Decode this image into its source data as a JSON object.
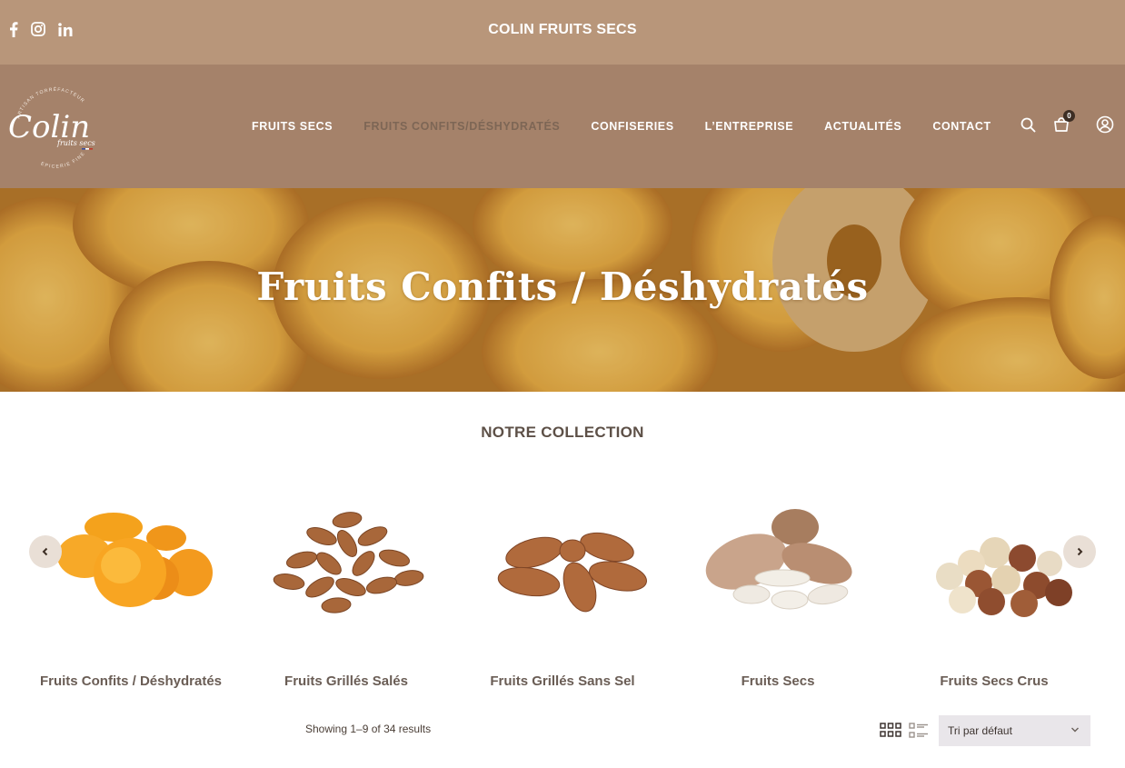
{
  "topbar": {
    "title": "COLIN FRUITS SECS",
    "social": [
      {
        "icon": "facebook-icon",
        "glyph": "f"
      },
      {
        "icon": "instagram-icon",
        "glyph": ""
      },
      {
        "icon": "linkedin-icon",
        "glyph": "in"
      }
    ]
  },
  "logo": {
    "main": "Colin",
    "sub": "fruits secs",
    "ring_top": "ARTISAN TORRÉFACTEUR",
    "ring_bottom": "EPICERIE FINE"
  },
  "nav": {
    "items": [
      {
        "label": "FRUITS SECS",
        "active": false
      },
      {
        "label": "FRUITS CONFITS/DÉSHYDRATÉS",
        "active": true
      },
      {
        "label": "CONFISERIES",
        "active": false
      },
      {
        "label": "L’ENTREPRISE",
        "active": false
      },
      {
        "label": "ACTUALITÉS",
        "active": false
      },
      {
        "label": "CONTACT",
        "active": false
      }
    ],
    "cart_count": "0"
  },
  "hero": {
    "title": "Fruits Confits / Déshydratés"
  },
  "collection": {
    "title": "NOTRE COLLECTION",
    "items": [
      {
        "label": "Fruits Confits / Déshydratés",
        "image": "dried-apricots"
      },
      {
        "label": "Fruits Grillés Salés",
        "image": "roasted-almonds-pile"
      },
      {
        "label": "Fruits Grillés Sans Sel",
        "image": "almonds"
      },
      {
        "label": "Fruits Secs",
        "image": "almonds-in-shell"
      },
      {
        "label": "Fruits Secs Crus",
        "image": "hazelnuts"
      }
    ]
  },
  "toolbar": {
    "results_text": "Showing 1–9 of 34 results",
    "sort_label": "Tri par défaut"
  },
  "colors": {
    "topbar": "#b8967a",
    "navbar": "#a5826a",
    "active_nav": "#7d6655",
    "hero": "#d49a3a"
  }
}
